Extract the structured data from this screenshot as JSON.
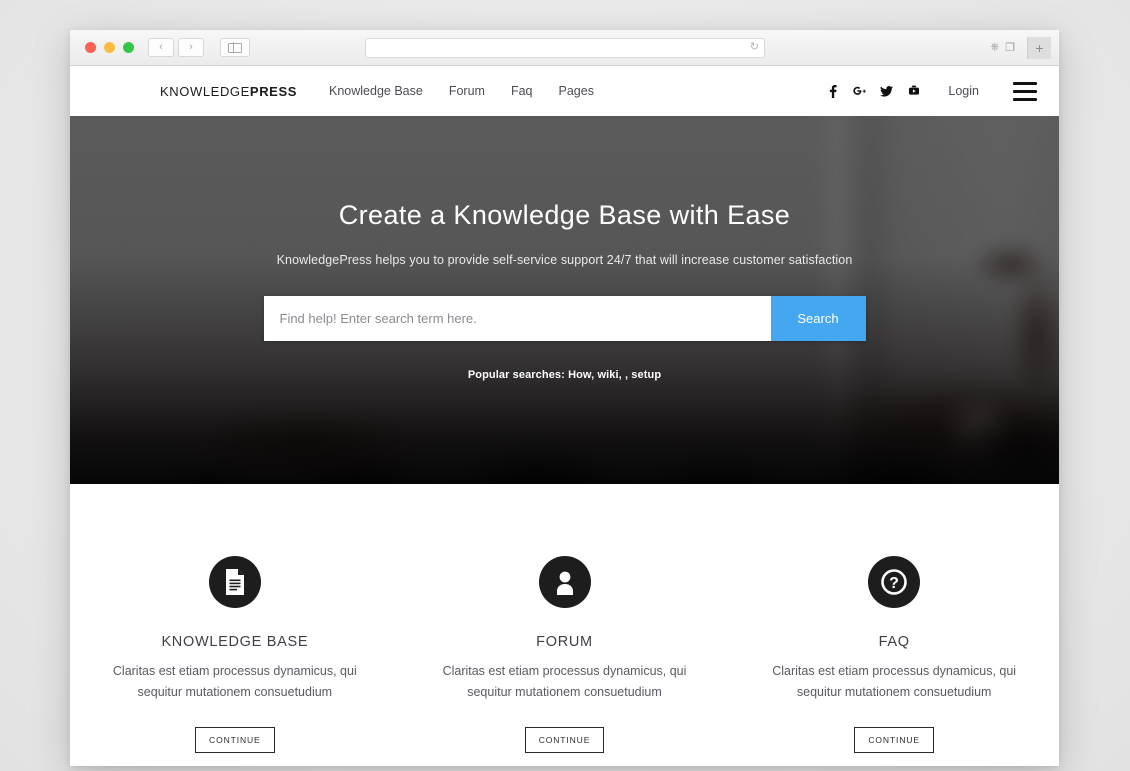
{
  "browser": {
    "address_value": "",
    "reload_icon": "reload-icon",
    "back_icon": "‹",
    "forward_icon": "›",
    "share_icon": "share-icon",
    "tabs_icon": "tabs-icon",
    "newtab_label": "+"
  },
  "header": {
    "logo_light": "KNOWLEDGE",
    "logo_bold": "PRESS",
    "nav": [
      {
        "label": "Knowledge Base"
      },
      {
        "label": "Forum"
      },
      {
        "label": "Faq"
      },
      {
        "label": "Pages"
      }
    ],
    "socials": [
      {
        "name": "facebook-icon"
      },
      {
        "name": "google-plus-icon"
      },
      {
        "name": "twitter-icon"
      },
      {
        "name": "youtube-icon"
      }
    ],
    "login_label": "Login",
    "menu_icon": "hamburger-menu-icon"
  },
  "hero": {
    "title": "Create a Knowledge Base with Ease",
    "subtitle": "KnowledgePress helps you to provide self-service support 24/7 that will increase customer satisfaction",
    "search_placeholder": "Find help! Enter search term here.",
    "search_value": "",
    "search_button": "Search",
    "popular": "Popular searches: How, wiki, , setup",
    "accent_color": "#44a7ef"
  },
  "features": [
    {
      "icon": "document-icon",
      "title": "KNOWLEDGE BASE",
      "desc": "Claritas est etiam processus dynamicus, qui sequitur mutationem consuetudium",
      "button": "CONTINUE"
    },
    {
      "icon": "user-icon",
      "title": "FORUM",
      "desc": "Claritas est etiam processus dynamicus, qui sequitur mutationem consuetudium",
      "button": "CONTINUE"
    },
    {
      "icon": "question-mark-icon",
      "title": "FAQ",
      "desc": "Claritas est etiam processus dynamicus, qui sequitur mutationem consuetudium",
      "button": "CONTINUE"
    }
  ]
}
